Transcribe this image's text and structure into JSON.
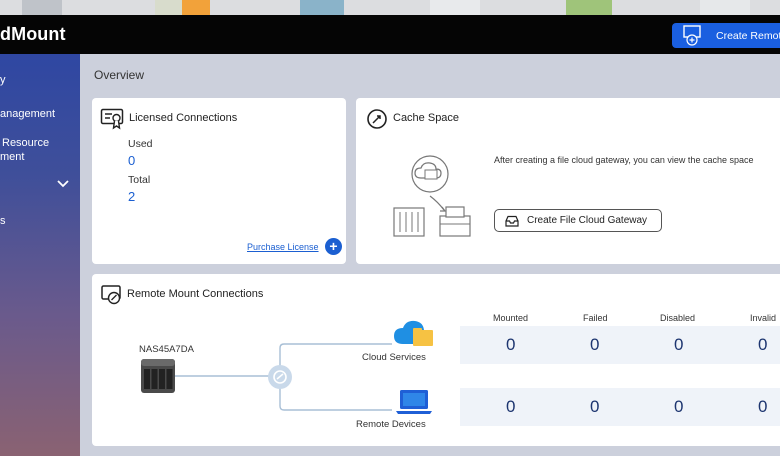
{
  "header": {
    "app_title": "dMount",
    "create_button": "Create Remot"
  },
  "sidebar": {
    "items": [
      {
        "label": "y"
      },
      {
        "label": "anagement"
      },
      {
        "label": "Resource"
      },
      {
        "label": "ment"
      },
      {
        "label": "s"
      }
    ]
  },
  "overview": {
    "title": "Overview"
  },
  "licensed": {
    "title": "Licensed Connections",
    "used_label": "Used",
    "used_value": "0",
    "total_label": "Total",
    "total_value": "2",
    "purchase_link": "Purchase License",
    "plus_symbol": "+"
  },
  "cache": {
    "title": "Cache Space",
    "description": "After creating a file cloud gateway, you can view the cache space",
    "create_button": "Create File Cloud Gateway"
  },
  "remote": {
    "title": "Remote Mount Connections",
    "nas_name": "NAS45A7DA",
    "cloud_label": "Cloud Services",
    "devices_label": "Remote Devices",
    "headers": [
      "Mounted",
      "Failed",
      "Disabled",
      "Invalid"
    ],
    "cloud_values": [
      "0",
      "0",
      "0",
      "0"
    ],
    "device_values": [
      "0",
      "0",
      "0",
      "0"
    ]
  },
  "colors": {
    "accent": "#1b5fd1",
    "header_bg": "#050505",
    "sidebar_top": "#2f47a2",
    "sidebar_bottom": "#8a6272"
  }
}
